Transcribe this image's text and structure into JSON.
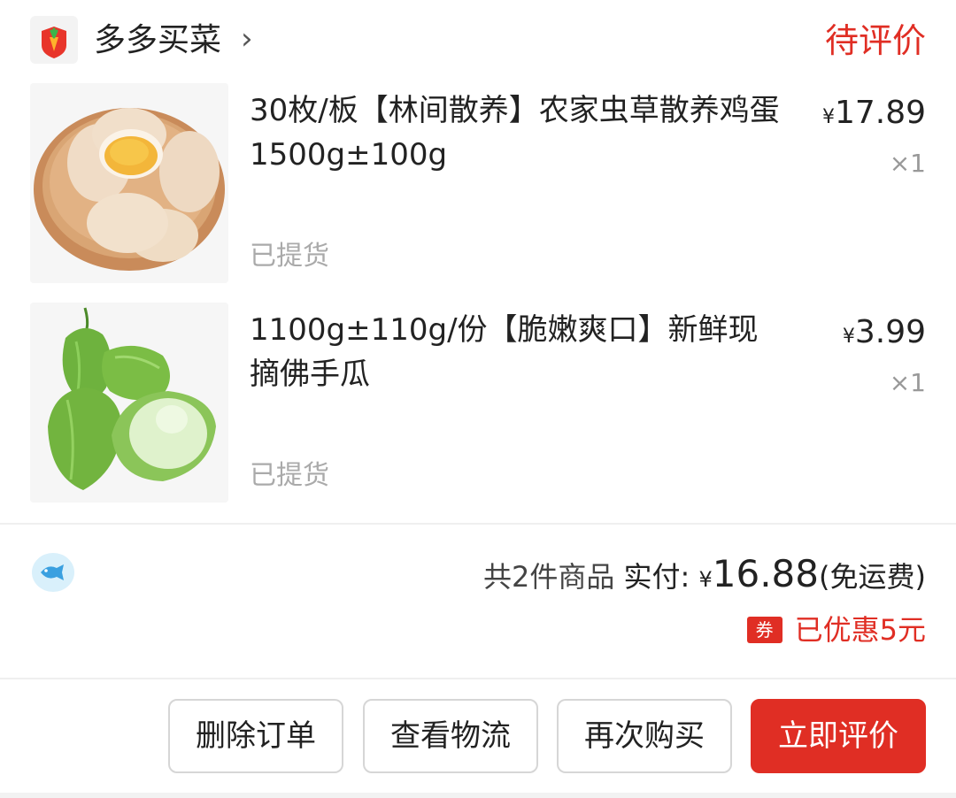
{
  "header": {
    "store_name": "多多买菜",
    "chevron": "›",
    "status": "待评价",
    "logo_icon": "carrot-logo-icon"
  },
  "items": [
    {
      "title": "30枚/板【林间散养】农家虫草散养鸡蛋1500g±100g",
      "currency": "¥",
      "price": "17.89",
      "qty": "×1",
      "status": "已提货",
      "image": "eggs-in-bowl"
    },
    {
      "title": "1100g±110g/份【脆嫩爽口】新鲜现摘佛手瓜",
      "currency": "¥",
      "price": "3.99",
      "qty": "×1",
      "status": "已提货",
      "image": "chayote-squash"
    }
  ],
  "summary": {
    "count_text": "共2件商品",
    "paid_label": "实付:",
    "currency": "¥",
    "amount": "16.88",
    "shipping_note": "(免运费)",
    "coupon_badge": "券",
    "discount_text": "已优惠5元"
  },
  "actions": {
    "delete": "删除订单",
    "logistics": "查看物流",
    "rebuy": "再次购买",
    "review": "立即评价"
  },
  "colors": {
    "accent": "#e02e24",
    "muted": "#aaaaaa"
  }
}
